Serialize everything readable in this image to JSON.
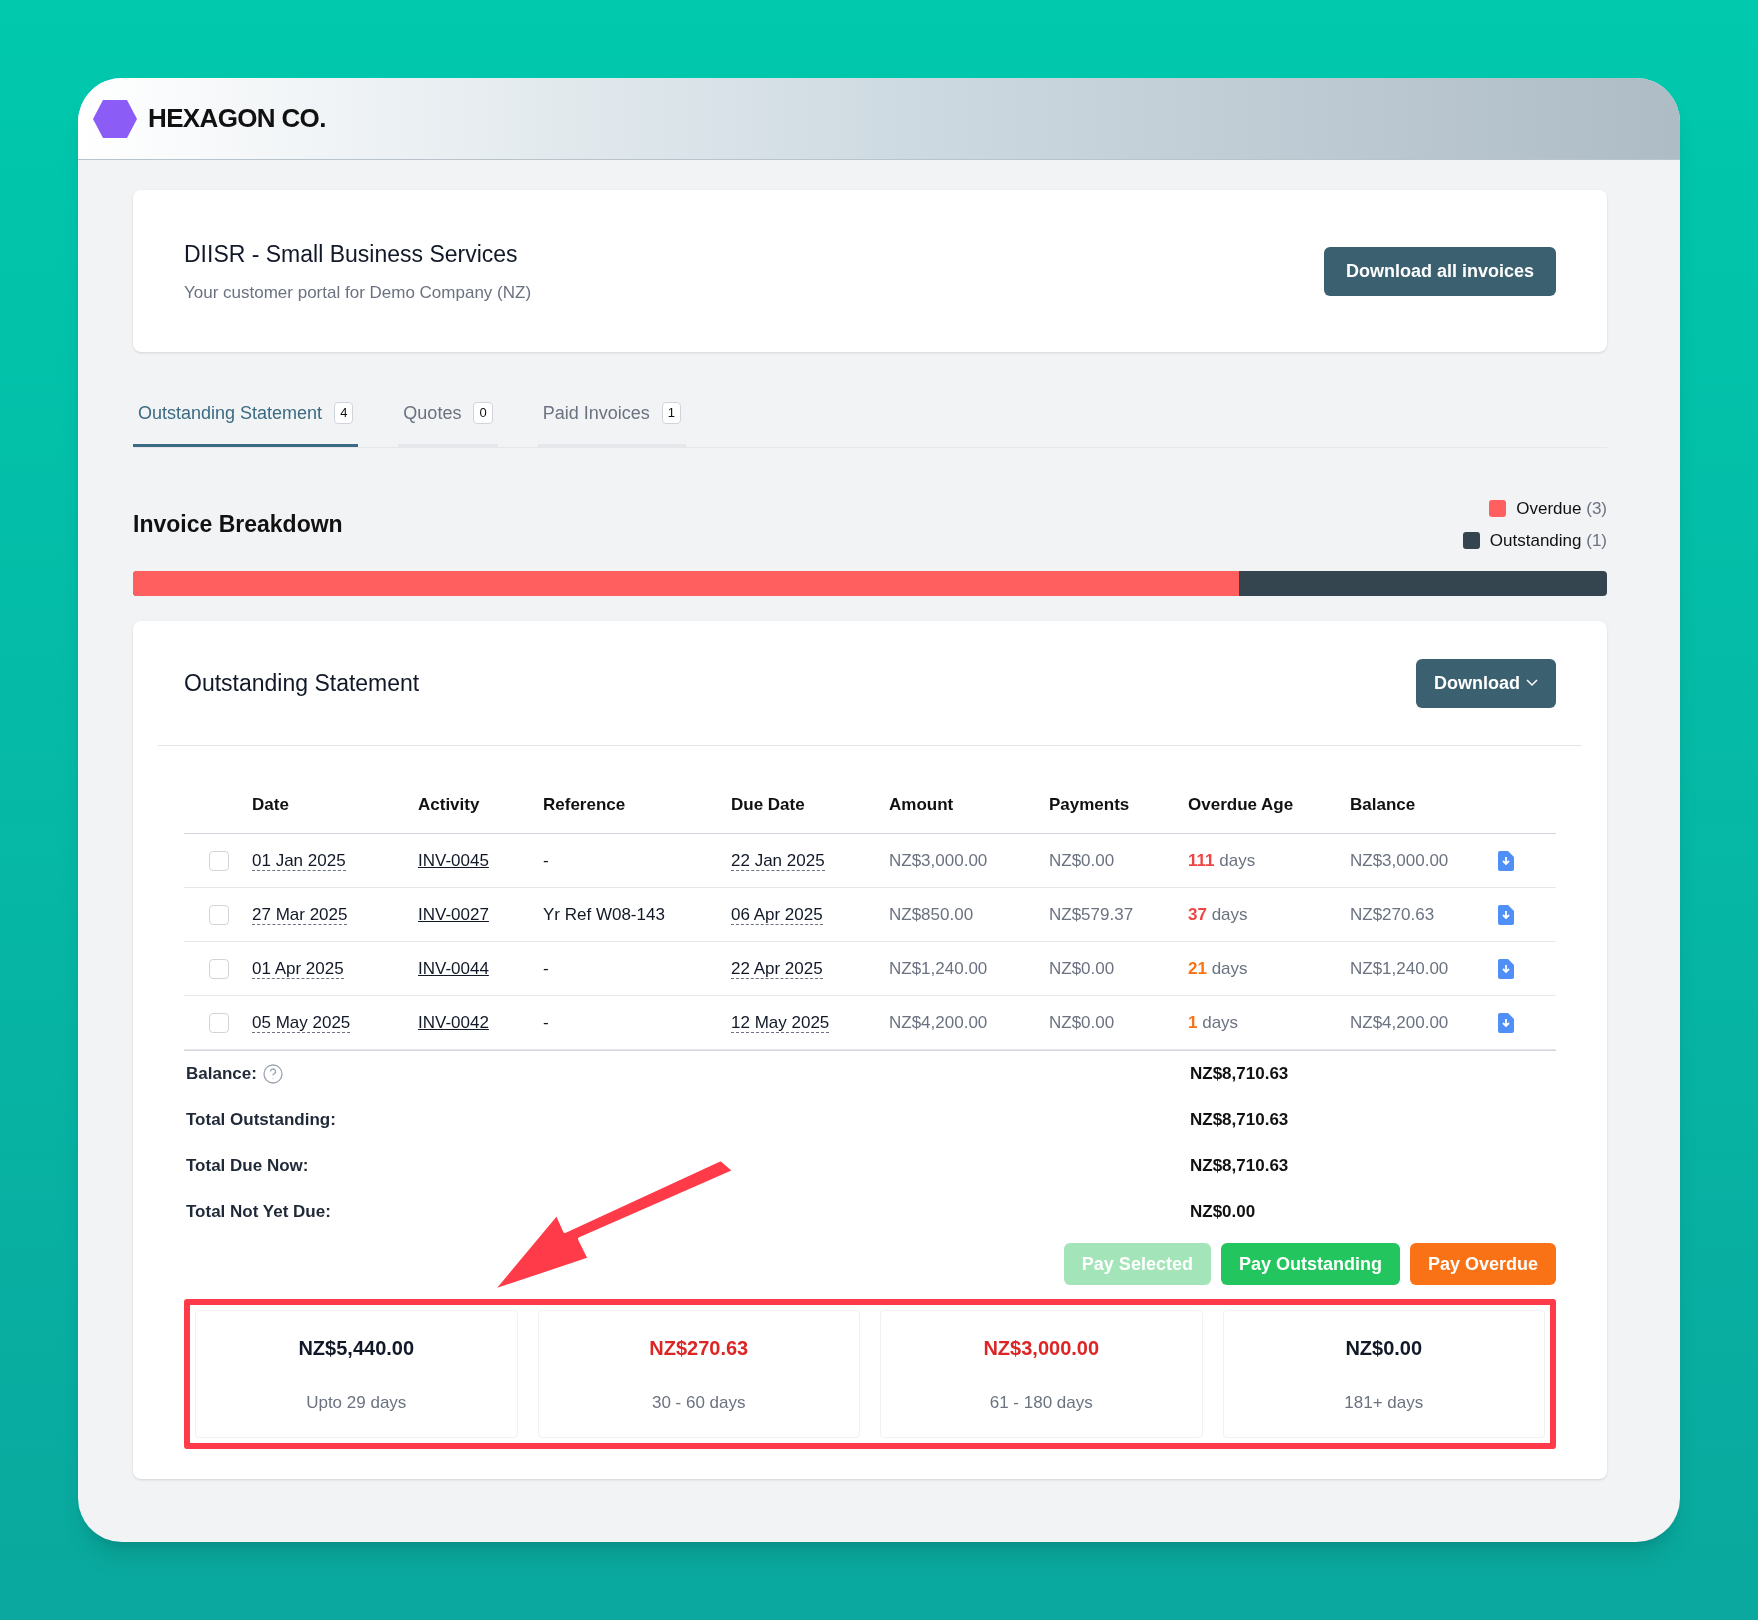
{
  "brand": {
    "name": "HEXAGON CO."
  },
  "customer": {
    "title": "DIISR - Small Business Services",
    "subtitle": "Your customer portal for Demo Company (NZ)",
    "button": "Download all invoices"
  },
  "tabs": [
    {
      "label": "Outstanding Statement",
      "count": "4",
      "selected": true
    },
    {
      "label": "Quotes",
      "count": "0",
      "selected": false
    },
    {
      "label": "Paid Invoices",
      "count": "1",
      "selected": false
    }
  ],
  "breakdown": {
    "title": "Invoice Breakdown",
    "legend": [
      {
        "label": "Overdue",
        "count": "(3)",
        "color": "#ff5f5f"
      },
      {
        "label": "Outstanding",
        "count": "(1)",
        "color": "#34454f"
      }
    ],
    "level": 0.75
  },
  "statement": {
    "title": "Outstanding Statement",
    "download": "Download",
    "columns": [
      "Date",
      "Activity",
      "Reference",
      "Due Date",
      "Amount",
      "Payments",
      "Overdue Age",
      "Balance"
    ],
    "rows": [
      {
        "checked": false,
        "date": "01 Jan 2025",
        "activity": "INV-0045",
        "reference": "-",
        "due": "22 Jan 2025",
        "amount": "NZ$3,000.00",
        "payments": "NZ$0.00",
        "age": "111",
        "age_unit": "days",
        "color": "#ef4444",
        "balance": "NZ$3,000.00"
      },
      {
        "checked": false,
        "date": "27 Mar 2025",
        "activity": "INV-0027",
        "reference": "Yr Ref W08-143",
        "due": "06 Apr 2025",
        "amount": "NZ$850.00",
        "payments": "NZ$579.37",
        "age": "37",
        "age_unit": "days",
        "color": "#ef4444",
        "balance": "NZ$270.63"
      },
      {
        "checked": false,
        "date": "01 Apr 2025",
        "activity": "INV-0044",
        "reference": "-",
        "due": "22 Apr 2025",
        "amount": "NZ$1,240.00",
        "payments": "NZ$0.00",
        "age": "21",
        "age_unit": "days",
        "color": "#f97316",
        "balance": "NZ$1,240.00"
      },
      {
        "checked": false,
        "date": "05 May 2025",
        "activity": "INV-0042",
        "reference": "-",
        "due": "12 May 2025",
        "amount": "NZ$4,200.00",
        "payments": "NZ$0.00",
        "age": "1",
        "age_unit": "days",
        "color": "#f97316",
        "balance": "NZ$4,200.00"
      }
    ],
    "totals": [
      {
        "label": "Balance:",
        "value": "NZ$8,710.63",
        "help": true
      },
      {
        "label": "Total Outstanding:",
        "value": "NZ$8,710.63",
        "help": false
      },
      {
        "label": "Total Due Now:",
        "value": "NZ$8,710.63",
        "help": false
      },
      {
        "label": "Total Not Yet Due:",
        "value": "NZ$0.00",
        "help": false
      }
    ],
    "actions": [
      {
        "label": "Pay Selected",
        "kind": "green",
        "disabled": true
      },
      {
        "label": "Pay Outstanding",
        "kind": "green",
        "disabled": false
      },
      {
        "label": "Pay Overdue",
        "kind": "orange",
        "disabled": false
      }
    ],
    "buckets": [
      {
        "amount": "NZ$5,440.00",
        "range": "Upto 29 days",
        "overdue": false
      },
      {
        "amount": "NZ$270.63",
        "range": "30 - 60 days",
        "overdue": true
      },
      {
        "amount": "NZ$3,000.00",
        "range": "61 - 180 days",
        "overdue": true
      },
      {
        "amount": "NZ$0.00",
        "range": "181+ days",
        "overdue": false
      }
    ]
  }
}
